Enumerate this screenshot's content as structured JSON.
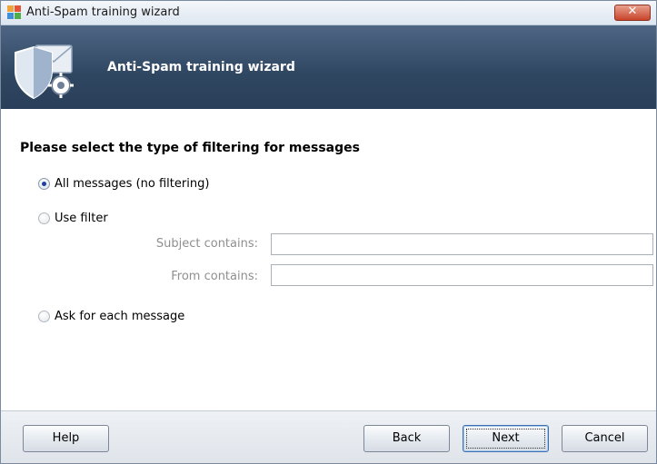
{
  "window": {
    "title": "Anti-Spam training wizard",
    "close_label": "✕"
  },
  "banner": {
    "title": "Anti-Spam training wizard"
  },
  "content": {
    "heading": "Please select the type of filtering for messages",
    "options": [
      {
        "label": "All messages (no filtering)",
        "checked": true
      },
      {
        "label": "Use filter",
        "checked": false
      },
      {
        "label": "Ask for each message",
        "checked": false
      }
    ],
    "filter_fields": {
      "subject_label": "Subject contains:",
      "subject_value": "",
      "from_label": "From contains:",
      "from_value": ""
    }
  },
  "footer": {
    "help_label": "Help",
    "back_label": "Back",
    "next_label": "Next",
    "cancel_label": "Cancel"
  },
  "colors": {
    "banner": "#2f4661",
    "titlebar": "#dde6f1",
    "close": "#c8442b",
    "disabled_text": "#8f8f8f"
  },
  "icons": {
    "app": "avg-logo-icon",
    "banner": "shield-mail-gear-icon"
  }
}
